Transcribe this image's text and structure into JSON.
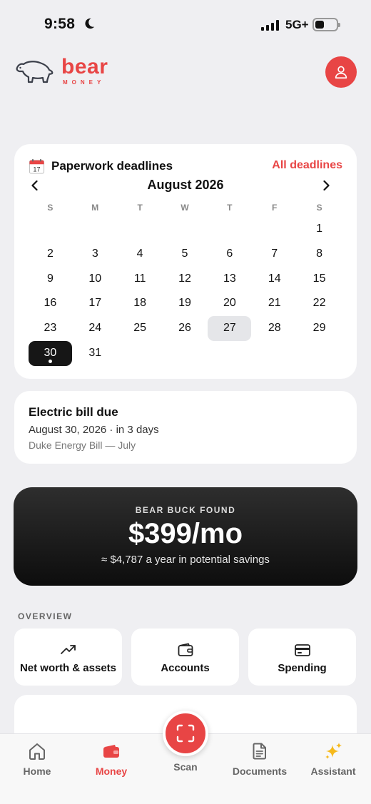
{
  "status": {
    "time": "9:58",
    "network": "5G+"
  },
  "brand": {
    "name": "bear",
    "sub": "MONEY",
    "accent": "#e84545"
  },
  "calendar": {
    "title": "Paperwork deadlines",
    "all_link": "All deadlines",
    "month": "August 2026",
    "weekdays": [
      "S",
      "M",
      "T",
      "W",
      "T",
      "F",
      "S"
    ],
    "leading_blanks": 6,
    "days": [
      "1",
      "2",
      "3",
      "4",
      "5",
      "6",
      "7",
      "8",
      "9",
      "10",
      "11",
      "12",
      "13",
      "14",
      "15",
      "16",
      "17",
      "18",
      "19",
      "20",
      "21",
      "22",
      "23",
      "24",
      "25",
      "26",
      "27",
      "28",
      "29",
      "30",
      "31"
    ],
    "today": "27",
    "selected": "30"
  },
  "bill": {
    "title": "Electric bill due",
    "date": "August 30, 2026  ·  in 3 days",
    "sub": "Duke Energy Bill — July"
  },
  "savings": {
    "label": "BEAR BUCK FOUND",
    "amount": "$399/mo",
    "sub": "≈ $4,787 a year in potential savings"
  },
  "overview": {
    "label": "OVERVIEW",
    "tiles": [
      {
        "label": "Net worth & assets",
        "icon": "trending-up-icon"
      },
      {
        "label": "Accounts",
        "icon": "wallet-icon"
      },
      {
        "label": "Spending",
        "icon": "credit-card-icon"
      }
    ]
  },
  "tabs": [
    {
      "label": "Home",
      "icon": "home-icon"
    },
    {
      "label": "Money",
      "icon": "wallet-icon"
    },
    {
      "label": "Scan",
      "icon": "scan-icon"
    },
    {
      "label": "Documents",
      "icon": "document-icon"
    },
    {
      "label": "Assistant",
      "icon": "sparkles-icon"
    }
  ]
}
